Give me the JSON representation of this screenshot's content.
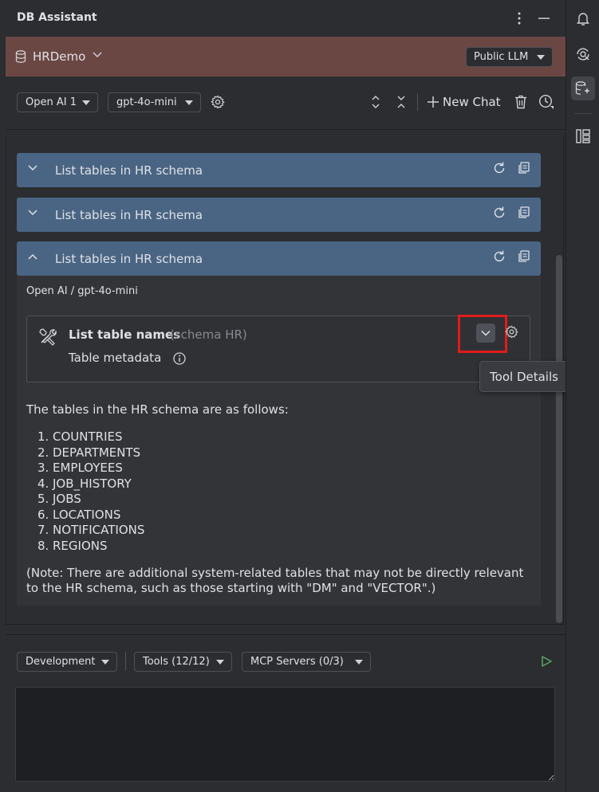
{
  "header": {
    "title": "DB Assistant"
  },
  "db_bar": {
    "connection": "HRDemo",
    "llm_mode": "Public LLM"
  },
  "toolbar": {
    "provider": "Open AI 1",
    "model": "gpt-4o-mini",
    "new_chat_label": "New Chat"
  },
  "conversation": {
    "prompts": [
      {
        "label": "List tables in HR schema",
        "expanded": false
      },
      {
        "label": "List tables in HR schema",
        "expanded": false
      },
      {
        "label": "List tables in HR schema",
        "expanded": true
      }
    ],
    "response": {
      "model_line": "Open AI / gpt-4o-mini",
      "tool_call": {
        "name": "List table names",
        "schema": "(schema HR)",
        "result_label": "Table metadata",
        "tooltip": "Tool Details"
      },
      "intro": "The tables in the HR schema are as follows:",
      "tables": [
        {
          "num": "1.",
          "name": "COUNTRIES"
        },
        {
          "num": "2.",
          "name": "DEPARTMENTS"
        },
        {
          "num": "3.",
          "name": "EMPLOYEES"
        },
        {
          "num": "4.",
          "name": "JOB_HISTORY"
        },
        {
          "num": "5.",
          "name": "JOBS"
        },
        {
          "num": "6.",
          "name": "LOCATIONS"
        },
        {
          "num": "7.",
          "name": "NOTIFICATIONS"
        },
        {
          "num": "8.",
          "name": "REGIONS"
        }
      ],
      "note": "(Note: There are additional system-related tables that may not be directly relevant to the HR schema, such as those starting with \"DM\" and \"VECTOR\".)"
    }
  },
  "bottom": {
    "profile": "Development",
    "tools": "Tools (12/12)",
    "mcp": "MCP Servers (0/3)",
    "input_value": ""
  },
  "colors": {
    "accordion": "#4a6584",
    "db_bar": "#6b4744",
    "highlight": "#e01b1b",
    "run": "#59a869"
  }
}
